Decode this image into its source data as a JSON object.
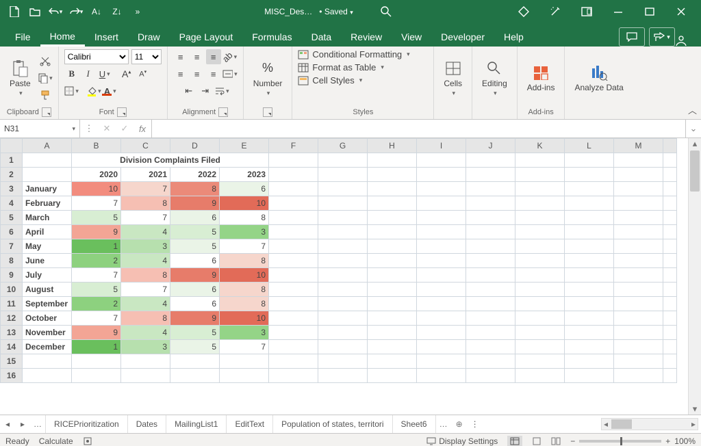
{
  "app": {
    "filename_short": "MISC_Des…",
    "saved_state": "• Saved"
  },
  "tabs": {
    "items": [
      "File",
      "Home",
      "Insert",
      "Draw",
      "Page Layout",
      "Formulas",
      "Data",
      "Review",
      "View",
      "Developer",
      "Help"
    ],
    "active": "Home"
  },
  "ribbon": {
    "font_name": "Calibri",
    "font_size": "11",
    "clipboard_label": "Clipboard",
    "paste_label": "Paste",
    "font_label": "Font",
    "alignment_label": "Alignment",
    "number_label": "Number",
    "styles_label": "Styles",
    "cond_format": "Conditional Formatting",
    "format_table": "Format as Table",
    "cell_styles": "Cell Styles",
    "cells_label": "Cells",
    "editing_label": "Editing",
    "addins_label": "Add-ins",
    "addins_group": "Add-ins",
    "analyze_label": "Analyze Data"
  },
  "formula_bar": {
    "name_box": "N31",
    "formula": "",
    "fx": "fx"
  },
  "grid": {
    "columns": [
      "A",
      "B",
      "C",
      "D",
      "E",
      "F",
      "G",
      "H",
      "I",
      "J",
      "K",
      "L",
      "M"
    ],
    "title": "Division Complaints Filed",
    "years": [
      "2020",
      "2021",
      "2022",
      "2023"
    ],
    "rows": [
      {
        "label": "January",
        "v": [
          10,
          7,
          8,
          6
        ],
        "c": [
          "#f28c7e",
          "#f6d6cc",
          "#eb8a79",
          "#eaf4e7"
        ]
      },
      {
        "label": "February",
        "v": [
          7,
          8,
          9,
          10
        ],
        "c": [
          "#ffffff",
          "#f6bfb3",
          "#e77c6a",
          "#e26b58"
        ]
      },
      {
        "label": "March",
        "v": [
          5,
          7,
          6,
          8
        ],
        "c": [
          "#d8eed3",
          "#ffffff",
          "#eaf4e7",
          "#ffffff"
        ]
      },
      {
        "label": "April",
        "v": [
          9,
          4,
          5,
          3
        ],
        "c": [
          "#f3a595",
          "#c9e7c2",
          "#d8eed3",
          "#94d487"
        ]
      },
      {
        "label": "May",
        "v": [
          1,
          3,
          5,
          7
        ],
        "c": [
          "#6abf5d",
          "#b7e0ae",
          "#eaf4e7",
          "#ffffff"
        ]
      },
      {
        "label": "June",
        "v": [
          2,
          4,
          6,
          8
        ],
        "c": [
          "#8dd17f",
          "#c9e7c2",
          "#ffffff",
          "#f6d6cc"
        ]
      },
      {
        "label": "July",
        "v": [
          7,
          8,
          9,
          10
        ],
        "c": [
          "#ffffff",
          "#f6bfb3",
          "#e77c6a",
          "#e26b58"
        ]
      },
      {
        "label": "August",
        "v": [
          5,
          7,
          6,
          8
        ],
        "c": [
          "#d8eed3",
          "#ffffff",
          "#eaf4e7",
          "#f6d6cc"
        ]
      },
      {
        "label": "September",
        "v": [
          2,
          4,
          6,
          8
        ],
        "c": [
          "#8dd17f",
          "#c9e7c2",
          "#ffffff",
          "#f6d6cc"
        ]
      },
      {
        "label": "October",
        "v": [
          7,
          8,
          9,
          10
        ],
        "c": [
          "#ffffff",
          "#f6bfb3",
          "#e77c6a",
          "#e26b58"
        ]
      },
      {
        "label": "November",
        "v": [
          9,
          4,
          5,
          3
        ],
        "c": [
          "#f3a595",
          "#c9e7c2",
          "#d8eed3",
          "#94d487"
        ]
      },
      {
        "label": "December",
        "v": [
          1,
          3,
          5,
          7
        ],
        "c": [
          "#6abf5d",
          "#b7e0ae",
          "#eaf4e7",
          "#ffffff"
        ]
      }
    ]
  },
  "chart_data": {
    "type": "table",
    "title": "Division Complaints Filed",
    "categories": [
      "January",
      "February",
      "March",
      "April",
      "May",
      "June",
      "July",
      "August",
      "September",
      "October",
      "November",
      "December"
    ],
    "series": [
      {
        "name": "2020",
        "values": [
          10,
          7,
          5,
          9,
          1,
          2,
          7,
          5,
          2,
          7,
          9,
          1
        ]
      },
      {
        "name": "2021",
        "values": [
          7,
          8,
          7,
          4,
          3,
          4,
          8,
          7,
          4,
          8,
          4,
          3
        ]
      },
      {
        "name": "2022",
        "values": [
          8,
          9,
          6,
          5,
          5,
          6,
          9,
          6,
          6,
          9,
          5,
          5
        ]
      },
      {
        "name": "2023",
        "values": [
          6,
          10,
          8,
          3,
          7,
          8,
          10,
          8,
          8,
          10,
          3,
          7
        ]
      }
    ]
  },
  "sheet_tabs": [
    "RICEPrioritization",
    "Dates",
    "MailingList1",
    "EditText",
    "Population of states, territori",
    "Sheet6"
  ],
  "status": {
    "ready": "Ready",
    "calculate": "Calculate",
    "display": "Display Settings",
    "zoom": "100%"
  }
}
